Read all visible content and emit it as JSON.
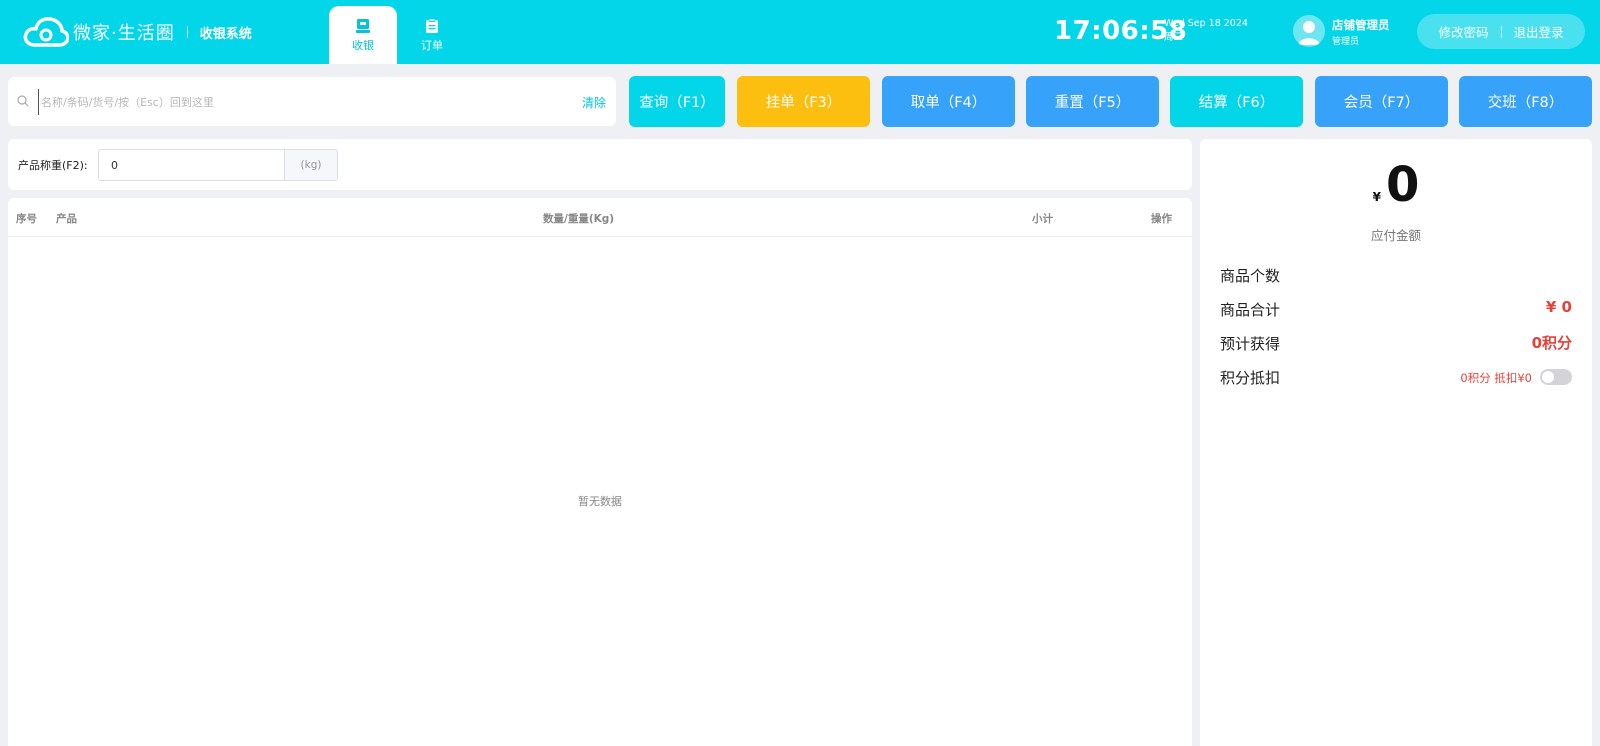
{
  "header": {
    "brand": "微家·生活圈",
    "system_title": "收银系统",
    "tabs": [
      {
        "label": "收银",
        "active": true,
        "icon": "cashier-icon"
      },
      {
        "label": "订单",
        "active": false,
        "icon": "order-list-icon"
      }
    ],
    "time": "17:06:58",
    "date": "Wed Sep 18 2024",
    "weekday": "周三",
    "user": {
      "name": "店铺管理员",
      "role": "管理员"
    },
    "change_password": "修改密码",
    "logout": "退出登录"
  },
  "search": {
    "placeholder": "名称/条码/货号/按（Esc）回到这里",
    "value": "",
    "clear_label": "清除"
  },
  "actions": [
    {
      "label": "查询（F1）",
      "color": "#04d6e9"
    },
    {
      "label": "挂单（F3）",
      "color": "#fdbf0f"
    },
    {
      "label": "取单（F4）",
      "color": "#37a2f9"
    },
    {
      "label": "重置（F5）",
      "color": "#37a2f9"
    },
    {
      "label": "结算（F6）",
      "color": "#04d6e9"
    },
    {
      "label": "会员（F7）",
      "color": "#37a2f9"
    },
    {
      "label": "交班（F8）",
      "color": "#37a2f9"
    }
  ],
  "weight": {
    "label": "产品称重(F2):",
    "value": "0",
    "unit": "(kg)"
  },
  "table": {
    "columns": [
      "序号",
      "产品",
      "数量/重量(Kg)",
      "小计",
      "操作"
    ],
    "rows": [],
    "empty_text": "暂无数据"
  },
  "summary": {
    "currency": "¥",
    "amount_due": "0",
    "amount_due_label": "应付金额",
    "item_count_label": "商品个数",
    "item_count": "",
    "item_total_label": "商品合计",
    "item_total": "¥ 0",
    "points_expected_label": "预计获得",
    "points_expected": "0积分",
    "points_deduct_label": "积分抵扣",
    "points_deduct_text": "0积分 抵扣¥0",
    "points_deduct_enabled": false
  },
  "colors": {
    "primary": "#04d6e9",
    "blue": "#37a2f9",
    "yellow": "#fdbf0f",
    "red": "#e5433a"
  }
}
